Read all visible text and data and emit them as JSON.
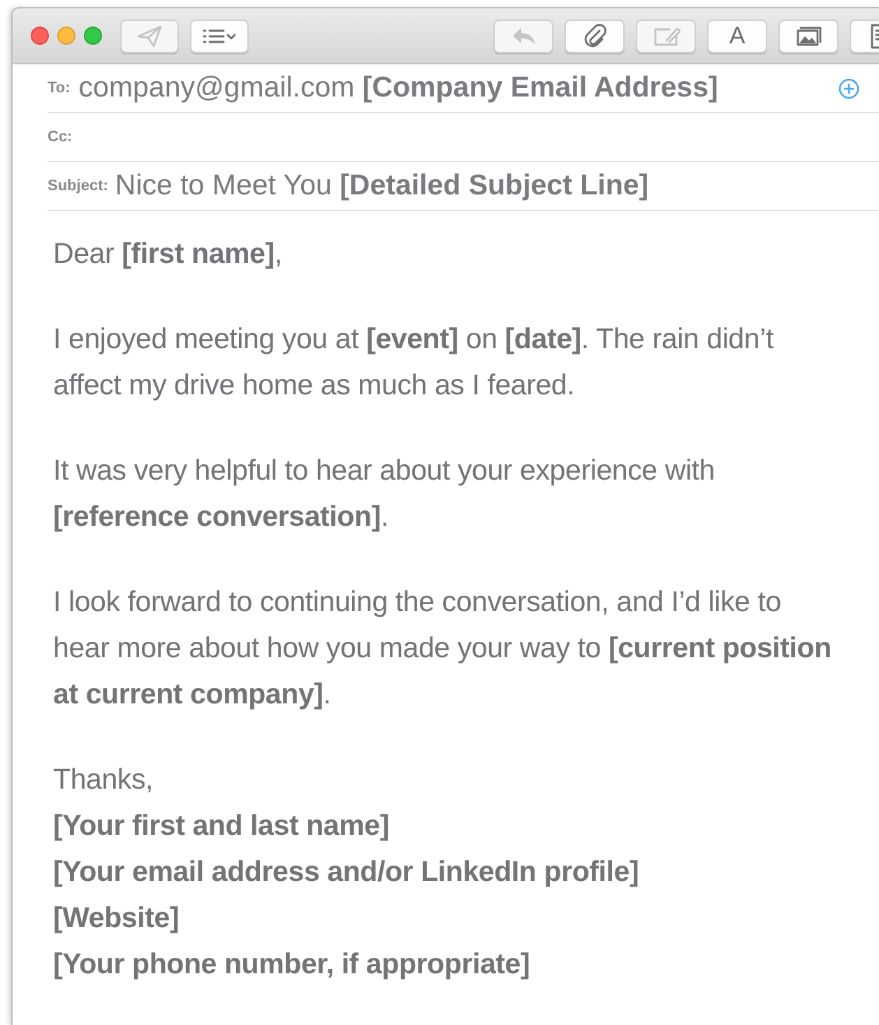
{
  "toolbar": {
    "left": [
      {
        "kind": "send",
        "disabled": true
      },
      {
        "kind": "list",
        "disabled": false
      }
    ],
    "right": [
      {
        "kind": "reply",
        "disabled": true
      },
      {
        "kind": "attach",
        "disabled": false
      },
      {
        "kind": "markup",
        "disabled": true
      },
      {
        "kind": "font",
        "label": "A",
        "disabled": false
      },
      {
        "kind": "photo",
        "disabled": false
      },
      {
        "kind": "document",
        "disabled": false
      }
    ]
  },
  "header": {
    "to": {
      "label": "To:",
      "value": "company@gmail.com **[Company Email Address]**"
    },
    "cc": {
      "label": "Cc:"
    },
    "subject": {
      "label": "Subject:",
      "value": "Nice to Meet You **[Detailed Subject Line]**"
    }
  },
  "body": {
    "paragraphs": [
      "Dear **[first name]**,",
      "I enjoyed meeting you at **[event]** on **[date]**. The rain didn’t affect my drive home as much as I feared.",
      "It was very helpful to hear about your experience with **[reference conversation]**.",
      "I look forward to continuing the conversation, and I’d like to hear more about how you made your way to **[current position at current company]**."
    ],
    "closing": "Thanks,",
    "signature": [
      "[Your first and last name]",
      "[Your email address and/or LinkedIn profile]",
      "[Website]",
      "[Your phone number, if appropriate]"
    ]
  }
}
